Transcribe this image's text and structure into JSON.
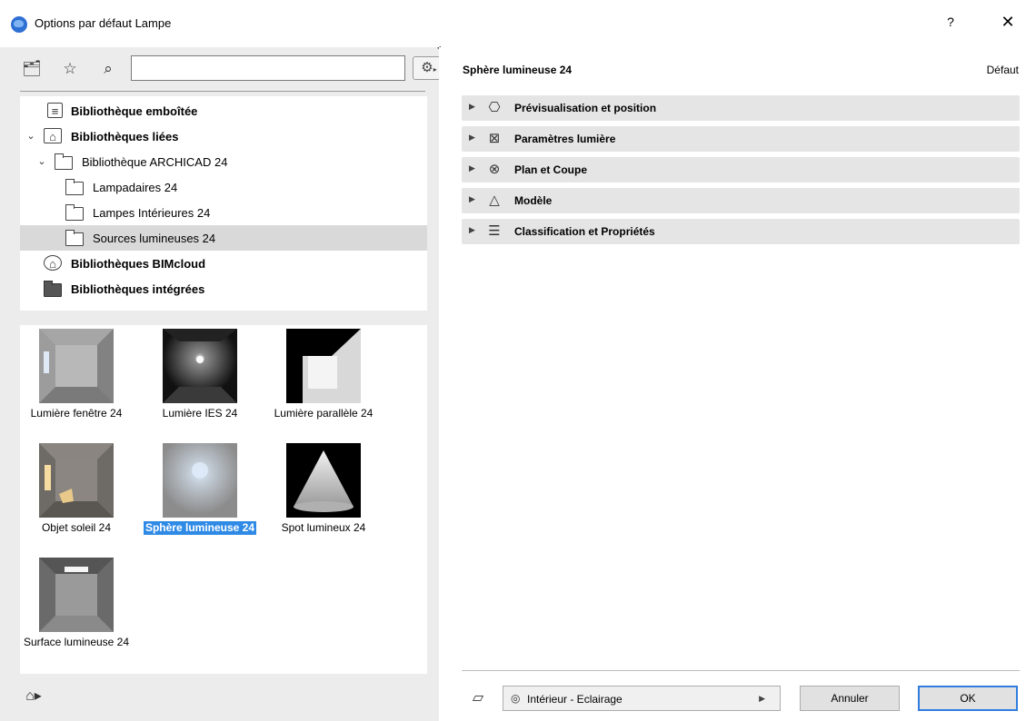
{
  "window": {
    "title": "Options par défaut Lampe",
    "help_label": "?",
    "close_label": "✕"
  },
  "toolbar": {
    "search_value": ""
  },
  "tree": [
    {
      "label": "Bibliothèque emboîtée",
      "bold": true
    },
    {
      "label": "Bibliothèques liées",
      "bold": true
    },
    {
      "label": "Bibliothèque ARCHICAD 24",
      "bold": false
    },
    {
      "label": "Lampadaires 24",
      "bold": false
    },
    {
      "label": "Lampes Intérieures 24",
      "bold": false
    },
    {
      "label": "Sources lumineuses 24",
      "bold": false,
      "selected": true
    },
    {
      "label": "Bibliothèques BIMcloud",
      "bold": true
    },
    {
      "label": "Bibliothèques intégrées",
      "bold": true
    }
  ],
  "objects": [
    {
      "label": "Lumière fenêtre 24"
    },
    {
      "label": "Lumière IES 24"
    },
    {
      "label": "Lumière parallèle 24"
    },
    {
      "label": "Objet soleil 24"
    },
    {
      "label": "Sphère lumineuse 24",
      "selected": true
    },
    {
      "label": "Spot lumineux 24"
    },
    {
      "label": "Surface lumineuse 24"
    }
  ],
  "settings": {
    "object_name": "Sphère lumineuse 24",
    "default_label": "Défaut",
    "sections": [
      {
        "label": "Prévisualisation et position",
        "icon": "preview-position-icon"
      },
      {
        "label": "Paramètres lumière",
        "icon": "light-parameters-icon"
      },
      {
        "label": "Plan et Coupe",
        "icon": "plan-section-icon"
      },
      {
        "label": "Modèle",
        "icon": "model-icon"
      },
      {
        "label": "Classification et Propriétés",
        "icon": "classification-icon"
      }
    ]
  },
  "footer": {
    "layer_value": "Intérieur - Eclairage",
    "cancel_label": "Annuler",
    "ok_label": "OK"
  },
  "colors": {
    "selection": "#2f8ae6",
    "ok_border": "#2f7de0",
    "section_bg": "#e5e5e5"
  }
}
